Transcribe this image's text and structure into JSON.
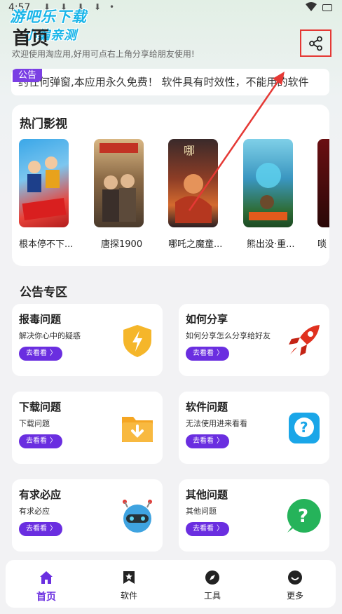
{
  "status_bar": {
    "time": "4:57",
    "dl1": "⬇",
    "dl2": "⬇",
    "dl3": "⬇",
    "dl4": "⬇",
    "dot": "•"
  },
  "watermark": {
    "line1": "游吧乐下载",
    "line2": "小编亲测"
  },
  "header": {
    "title": "首页",
    "subtitle": "欢迎使用淘应用,好用可点右上角分享给朋友使用!"
  },
  "notice": {
    "tag": "公告",
    "text": "约任何弹窗,本应用永久免费！   软件具有时效性，不能用的软件"
  },
  "hot": {
    "title": "热门影视",
    "movies": [
      {
        "name": "根本停不下..."
      },
      {
        "name": "唐探1900"
      },
      {
        "name": "哪吒之魔童..."
      },
      {
        "name": "熊出没·重..."
      },
      {
        "name": "唢"
      }
    ]
  },
  "announcements": {
    "title": "公告专区",
    "go_label": "去看看",
    "items": [
      {
        "title": "报毒问题",
        "desc": "解决你心中的疑惑",
        "icon": "shield-lightning-icon"
      },
      {
        "title": "如何分享",
        "desc": "如何分享怎么分享给好友",
        "icon": "rocket-icon"
      },
      {
        "title": "下载问题",
        "desc": "下载问题",
        "icon": "download-folder-icon"
      },
      {
        "title": "软件问题",
        "desc": "无法使用进来看看",
        "icon": "question-chat-icon"
      },
      {
        "title": "有求必应",
        "desc": "有求必应",
        "icon": "robot-icon"
      },
      {
        "title": "其他问题",
        "desc": "其他问题",
        "icon": "help-bubble-icon"
      }
    ]
  },
  "nav": [
    {
      "label": "首页",
      "icon": "home-icon"
    },
    {
      "label": "软件",
      "icon": "bookmark-star-icon"
    },
    {
      "label": "工具",
      "icon": "compass-icon"
    },
    {
      "label": "更多",
      "icon": "smile-icon"
    }
  ],
  "colors": {
    "accent": "#6a2ee0",
    "highlight_box": "#e53935",
    "watermark": "#19b5e8"
  }
}
